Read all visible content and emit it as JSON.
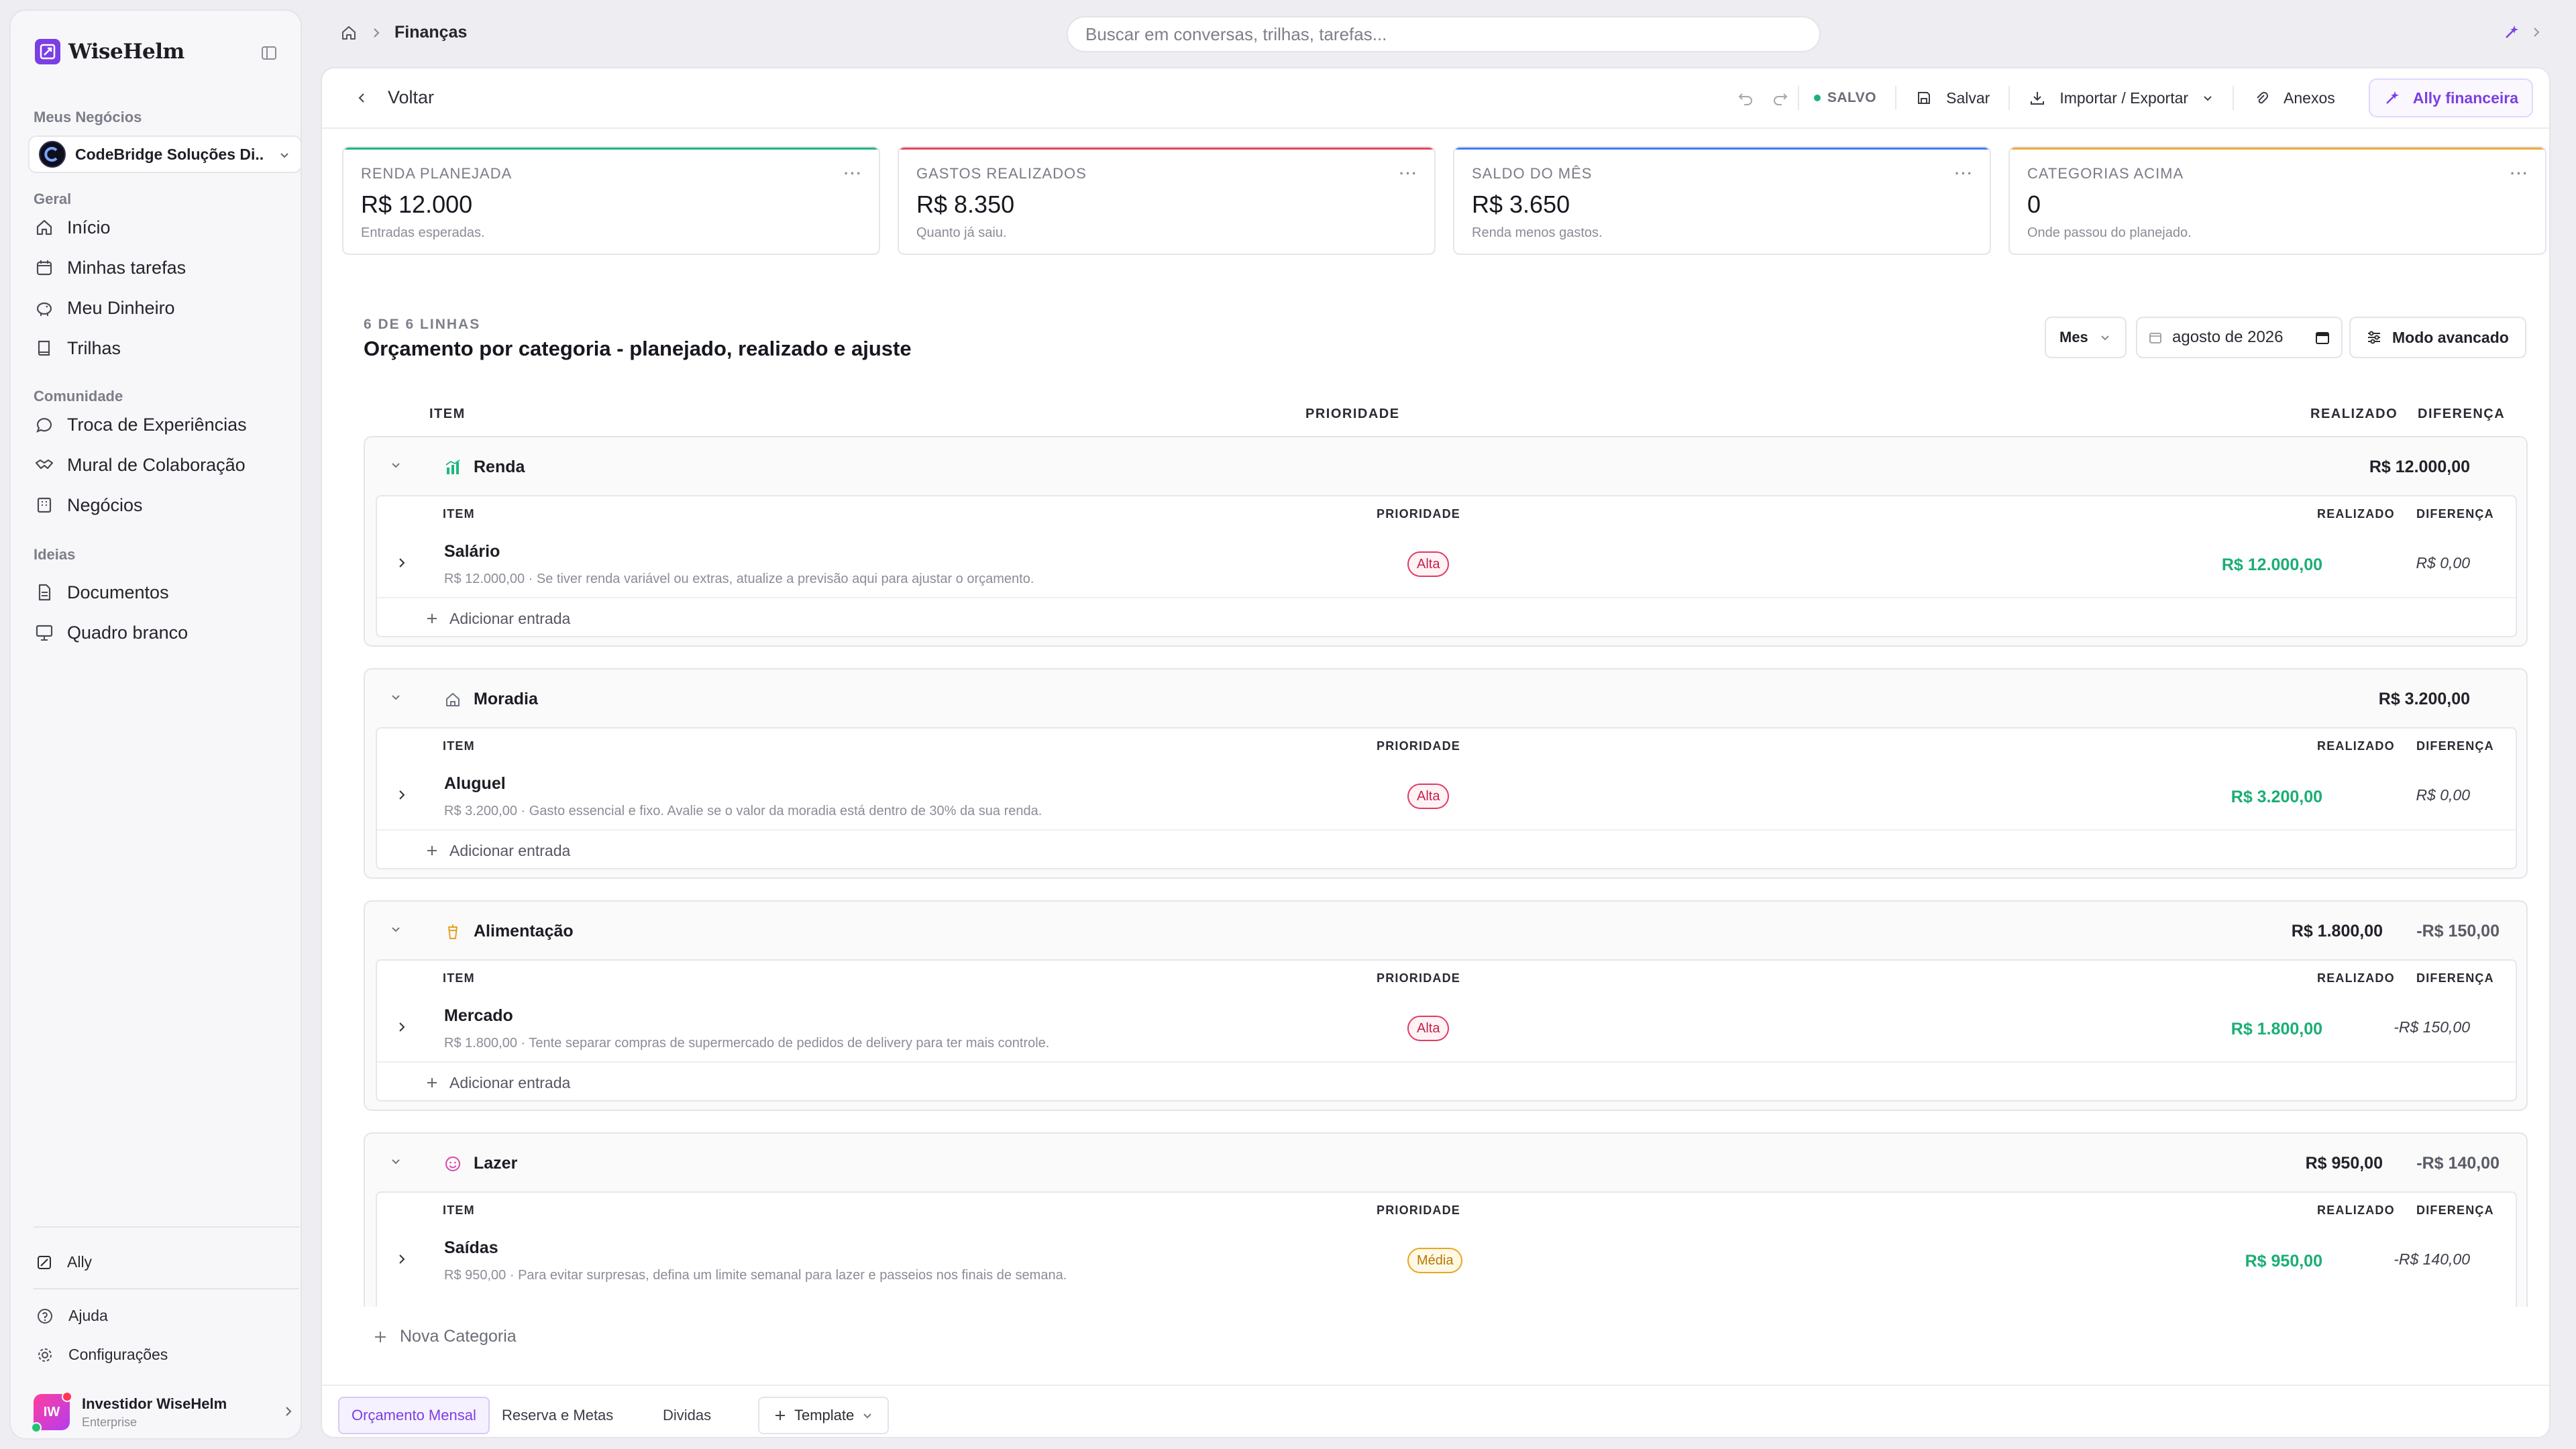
{
  "app": {
    "name": "WiseHelm"
  },
  "sidebar": {
    "my_business_label": "Meus Negócios",
    "business_name": "CodeBridge Soluções Di...",
    "sections": [
      {
        "label": "Geral",
        "items": [
          {
            "label": "Início",
            "icon": "home-icon"
          },
          {
            "label": "Minhas tarefas",
            "icon": "calendar-icon"
          },
          {
            "label": "Meu Dinheiro",
            "icon": "piggy-bank-icon"
          },
          {
            "label": "Trilhas",
            "icon": "book-icon"
          }
        ]
      },
      {
        "label": "Comunidade",
        "items": [
          {
            "label": "Troca de Experiências",
            "icon": "chat-icon"
          },
          {
            "label": "Mural de Colaboração",
            "icon": "handshake-icon"
          },
          {
            "label": "Negócios",
            "icon": "building-icon"
          }
        ]
      },
      {
        "label": "Ideias",
        "items": [
          {
            "label": "Documentos",
            "icon": "document-icon"
          },
          {
            "label": "Quadro branco",
            "icon": "whiteboard-icon"
          }
        ]
      }
    ],
    "footer": {
      "ally": "Ally",
      "help": "Ajuda",
      "settings": "Configurações"
    },
    "user": {
      "initials": "IW",
      "name": "Investidor WiseHelm",
      "plan": "Enterprise"
    }
  },
  "topbar": {
    "breadcrumb": "Finanças",
    "search_placeholder": "Buscar em conversas, trilhas, tarefas..."
  },
  "toolbar": {
    "back": "Voltar",
    "status": "SALVO",
    "save": "Salvar",
    "import_export": "Importar / Exportar",
    "attachments": "Anexos",
    "ally_finance": "Ally financeira"
  },
  "stats": [
    {
      "label": "RENDA PLANEJADA",
      "value": "R$ 12.000",
      "sub": "Entradas esperadas.",
      "color": "#1fb67d"
    },
    {
      "label": "GASTOS REALIZADOS",
      "value": "R$ 8.350",
      "sub": "Quanto já saiu.",
      "color": "#e5485f"
    },
    {
      "label": "SALDO DO MÊS",
      "value": "R$ 3.650",
      "sub": "Renda menos gastos.",
      "color": "#3b82f6"
    },
    {
      "label": "CATEGORIAS ACIMA",
      "value": "0",
      "sub": "Onde passou do planejado.",
      "color": "#f0a93a"
    }
  ],
  "budget": {
    "row_count": "6 DE 6 LINHAS",
    "title": "Orçamento por categoria - planejado, realizado e ajuste",
    "period": "Mes",
    "date": "agosto de 2026",
    "advanced_mode": "Modo avancado",
    "columns": {
      "item": "ITEM",
      "priority": "PRIORIDADE",
      "realized": "REALIZADO",
      "difference": "DIFERENÇA"
    },
    "add_entry": "Adicionar entrada",
    "categories": [
      {
        "name": "Renda",
        "icon": "bar-chart-icon",
        "icon_color": "#1fb67d",
        "total": "R$ 12.000,00",
        "diff": "",
        "item": {
          "name": "Salário",
          "desc": "R$ 12.000,00 · Se tiver renda variável ou extras, atualize a previsão aqui para ajustar o orçamento.",
          "priority": "Alta",
          "realized": "R$ 12.000,00",
          "diff": "R$ 0,00"
        }
      },
      {
        "name": "Moradia",
        "icon": "house-icon",
        "icon_color": "#6b7280",
        "total": "R$ 3.200,00",
        "diff": "",
        "item": {
          "name": "Aluguel",
          "desc": "R$ 3.200,00 · Gasto essencial e fixo. Avalie se o valor da moradia está dentro de 30% da sua renda.",
          "priority": "Alta",
          "realized": "R$ 3.200,00",
          "diff": "R$ 0,00"
        }
      },
      {
        "name": "Alimentação",
        "icon": "cup-icon",
        "icon_color": "#e5a21a",
        "total": "R$ 1.800,00",
        "diff": "-R$ 150,00",
        "item": {
          "name": "Mercado",
          "desc": "R$ 1.800,00 · Tente separar compras de supermercado de pedidos de delivery para ter mais controle.",
          "priority": "Alta",
          "realized": "R$ 1.800,00",
          "diff": "-R$ 150,00"
        }
      },
      {
        "name": "Lazer",
        "icon": "smile-icon",
        "icon_color": "#d946a8",
        "total": "R$ 950,00",
        "diff": "-R$ 140,00",
        "item": {
          "name": "Saídas",
          "desc": "R$ 950,00 · Para evitar surpresas, defina um limite semanal para lazer e passeios nos finais de semana.",
          "priority": "Média",
          "realized": "R$ 950,00",
          "diff": "-R$ 140,00"
        }
      }
    ],
    "new_category": "Nova Categoria"
  },
  "tabs": [
    "Orçamento Mensal",
    "Reserva e Metas",
    "Dividas"
  ],
  "template_btn": "Template"
}
